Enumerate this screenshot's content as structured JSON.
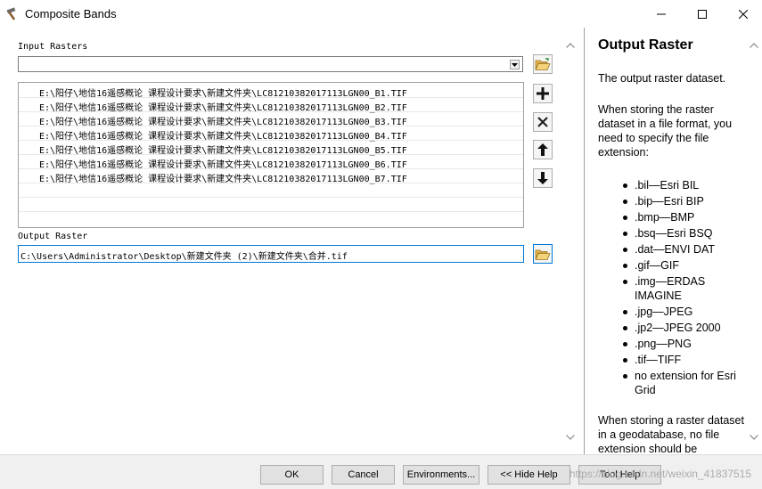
{
  "window": {
    "title": "Composite Bands",
    "minimize_icon": "minimize-icon",
    "maximize_icon": "maximize-icon",
    "close_icon": "close-icon"
  },
  "form": {
    "input_rasters_label": "Input Rasters",
    "input_rasters_value": "",
    "input_rasters": [
      "E:\\阳仔\\地信16遥感概论  课程设计要求\\新建文件夹\\LC81210382017113LGN00_B1.TIF",
      "E:\\阳仔\\地信16遥感概论  课程设计要求\\新建文件夹\\LC81210382017113LGN00_B2.TIF",
      "E:\\阳仔\\地信16遥感概论  课程设计要求\\新建文件夹\\LC81210382017113LGN00_B3.TIF",
      "E:\\阳仔\\地信16遥感概论  课程设计要求\\新建文件夹\\LC81210382017113LGN00_B4.TIF",
      "E:\\阳仔\\地信16遥感概论  课程设计要求\\新建文件夹\\LC81210382017113LGN00_B5.TIF",
      "E:\\阳仔\\地信16遥感概论  课程设计要求\\新建文件夹\\LC81210382017113LGN00_B6.TIF",
      "E:\\阳仔\\地信16遥感概论  课程设计要求\\新建文件夹\\LC81210382017113LGN00_B7.TIF"
    ],
    "output_raster_label": "Output Raster",
    "output_raster_value": "C:\\Users\\Administrator\\Desktop\\新建文件夹 (2)\\新建文件夹\\合并.tif"
  },
  "help": {
    "title": "Output Raster",
    "p1": "The output raster dataset.",
    "p2": "When storing the raster dataset in a file format, you need to specify the file extension:",
    "extensions": [
      ".bil—Esri BIL",
      ".bip—Esri BIP",
      ".bmp—BMP",
      ".bsq—Esri BSQ",
      ".dat—ENVI DAT",
      ".gif—GIF",
      ".img—ERDAS IMAGINE",
      ".jpg—JPEG",
      ".jp2—JPEG 2000",
      ".png—PNG",
      ".tif—TIFF",
      "no extension for Esri Grid"
    ],
    "p3": "When storing a raster dataset in a geodatabase, no file extension should be"
  },
  "footer": {
    "ok": "OK",
    "cancel": "Cancel",
    "environments": "Environments...",
    "hide_help": "<< Hide Help",
    "tool_help": "Tool Help",
    "watermark": "https://blog.csdn.net/weixin_41837515"
  },
  "colors": {
    "accent": "#0078d7",
    "folder": "#e8b84a"
  }
}
